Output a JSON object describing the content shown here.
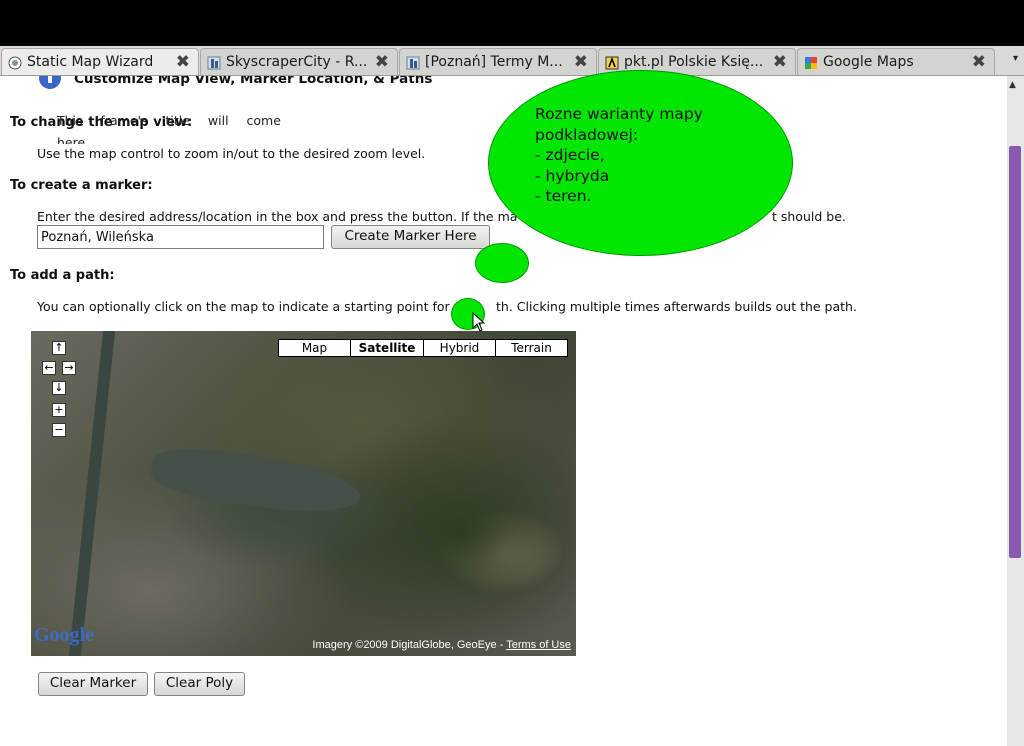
{
  "browser": {
    "tabs": [
      {
        "title": "Static Map Wizard",
        "icon": "page-icon",
        "active": true
      },
      {
        "title": "SkyscraperCity - R...",
        "icon": "skyscrapercity-icon",
        "active": false
      },
      {
        "title": "[Poznań] Termy M...",
        "icon": "skyscrapercity-icon",
        "active": false
      },
      {
        "title": "pkt.pl Polskie Księ...",
        "icon": "pkt-icon",
        "active": false
      },
      {
        "title": "Google Maps",
        "icon": "google-maps-icon",
        "active": false
      }
    ],
    "close_glyph": "✖",
    "tab_list_glyph": "▾"
  },
  "page": {
    "section_title": "Customize Map View, Marker Location, & Paths",
    "frame_title_placeholder": "This frame's title will come here",
    "change_view": {
      "heading": "To change the map view:",
      "text": "Use the map control to zoom in/out to the desired zoom level."
    },
    "create_marker": {
      "heading": "To create a marker:",
      "text_left": "Enter the desired address/location in the box and press the button. If the ma",
      "text_right": "t should be.",
      "input_value": "Poznań, Wileńska",
      "button_label": "Create Marker Here"
    },
    "add_path": {
      "heading": "To add a path:",
      "text_left": "You can optionally click on the map to indicate a starting point for",
      "text_right": "th. Clicking multiple times afterwards builds out the path."
    },
    "map": {
      "types": [
        "Map",
        "Satellite",
        "Hybrid",
        "Terrain"
      ],
      "selected_type": "Satellite",
      "controls": {
        "up": "↑",
        "left": "←",
        "right": "→",
        "down": "↓",
        "zoom_in": "+",
        "zoom_out": "−"
      },
      "logo": "Google",
      "attribution": "Imagery ©2009 DigitalGlobe, GeoEye - ",
      "terms_link": "Terms of Use"
    },
    "buttons": {
      "clear_marker": "Clear Marker",
      "clear_poly": "Clear Poly"
    }
  },
  "annotation": {
    "line1": "Rozne warianty mapy",
    "line2": "podkladowej:",
    "line3": "- zdjecie,",
    "line4": "- hybryda",
    "line5": "- teren.",
    "color": "#00e600"
  },
  "scrollbar": {
    "thumb_color": "#8a5ab0"
  }
}
